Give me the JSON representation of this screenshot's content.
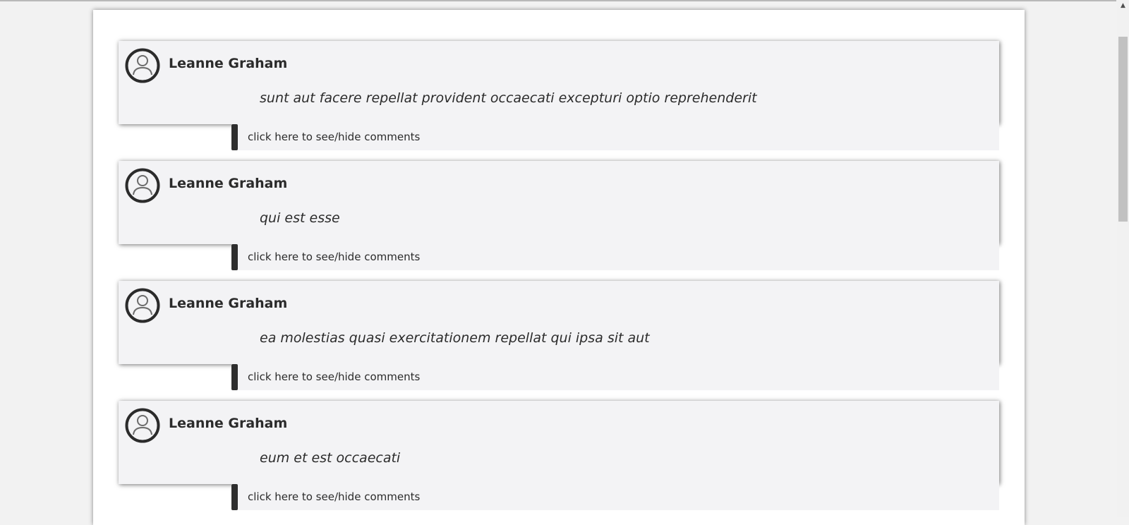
{
  "posts": [
    {
      "author": "Leanne Graham",
      "title": "sunt aut facere repellat provident occaecati excepturi optio reprehenderit",
      "comments_toggle": "click here to see/hide comments"
    },
    {
      "author": "Leanne Graham",
      "title": "qui est esse",
      "comments_toggle": "click here to see/hide comments"
    },
    {
      "author": "Leanne Graham",
      "title": "ea molestias quasi exercitationem repellat qui ipsa sit aut",
      "comments_toggle": "click here to see/hide comments"
    },
    {
      "author": "Leanne Graham",
      "title": "eum et est occaecati",
      "comments_toggle": "click here to see/hide comments"
    }
  ],
  "icons": {
    "avatar": "user-circle-icon",
    "scroll_up": "triangle-up-icon"
  },
  "colors": {
    "page_background": "#f2f2f2",
    "card_background": "#f3f3f5",
    "text": "#2b2b2b",
    "handle": "#2e2e2e"
  }
}
